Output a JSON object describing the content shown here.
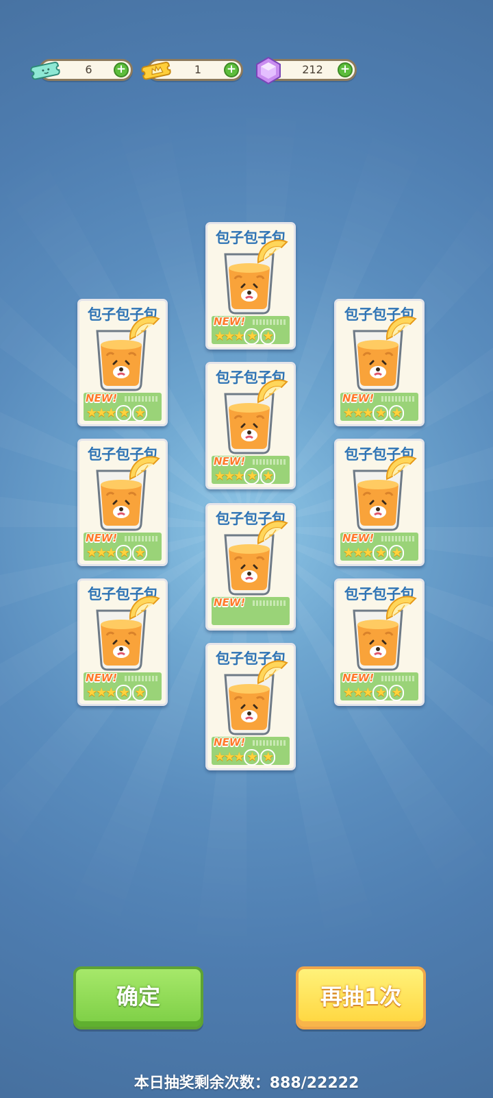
{
  "currencies": [
    {
      "name": "ticket",
      "value": "6"
    },
    {
      "name": "vip-ticket",
      "value": "1"
    },
    {
      "name": "gem",
      "value": "212"
    }
  ],
  "currency_plus": "+",
  "cards": [
    {
      "name": "包子包子包",
      "new": "NEW!",
      "stars": 5
    },
    {
      "name": "包子包子包",
      "new": "NEW!",
      "stars": 5
    },
    {
      "name": "包子包子包",
      "new": "NEW!",
      "stars": 5
    },
    {
      "name": "包子包子包",
      "new": "NEW!",
      "stars": 5
    },
    {
      "name": "包子包子包",
      "new": "NEW!",
      "stars": 5
    },
    {
      "name": "包子包子包",
      "new": "NEW!",
      "stars": 0
    },
    {
      "name": "包子包子包",
      "new": "NEW!",
      "stars": 5
    },
    {
      "name": "包子包子包",
      "new": "NEW!",
      "stars": 5
    },
    {
      "name": "包子包子包",
      "new": "NEW!",
      "stars": 5
    },
    {
      "name": "包子包子包",
      "new": "NEW!",
      "stars": 5
    }
  ],
  "buttons": {
    "confirm": "确定",
    "draw_again": "再抽1次"
  },
  "remaining_text": "本日抽奖剩余次数：888/22222",
  "colors": {
    "card_title": "#2f74b5",
    "new_tag": "#ff7a2a",
    "rank_band": "#9ad378",
    "confirm": "#7cce44",
    "draw_again": "#ffd53d"
  }
}
